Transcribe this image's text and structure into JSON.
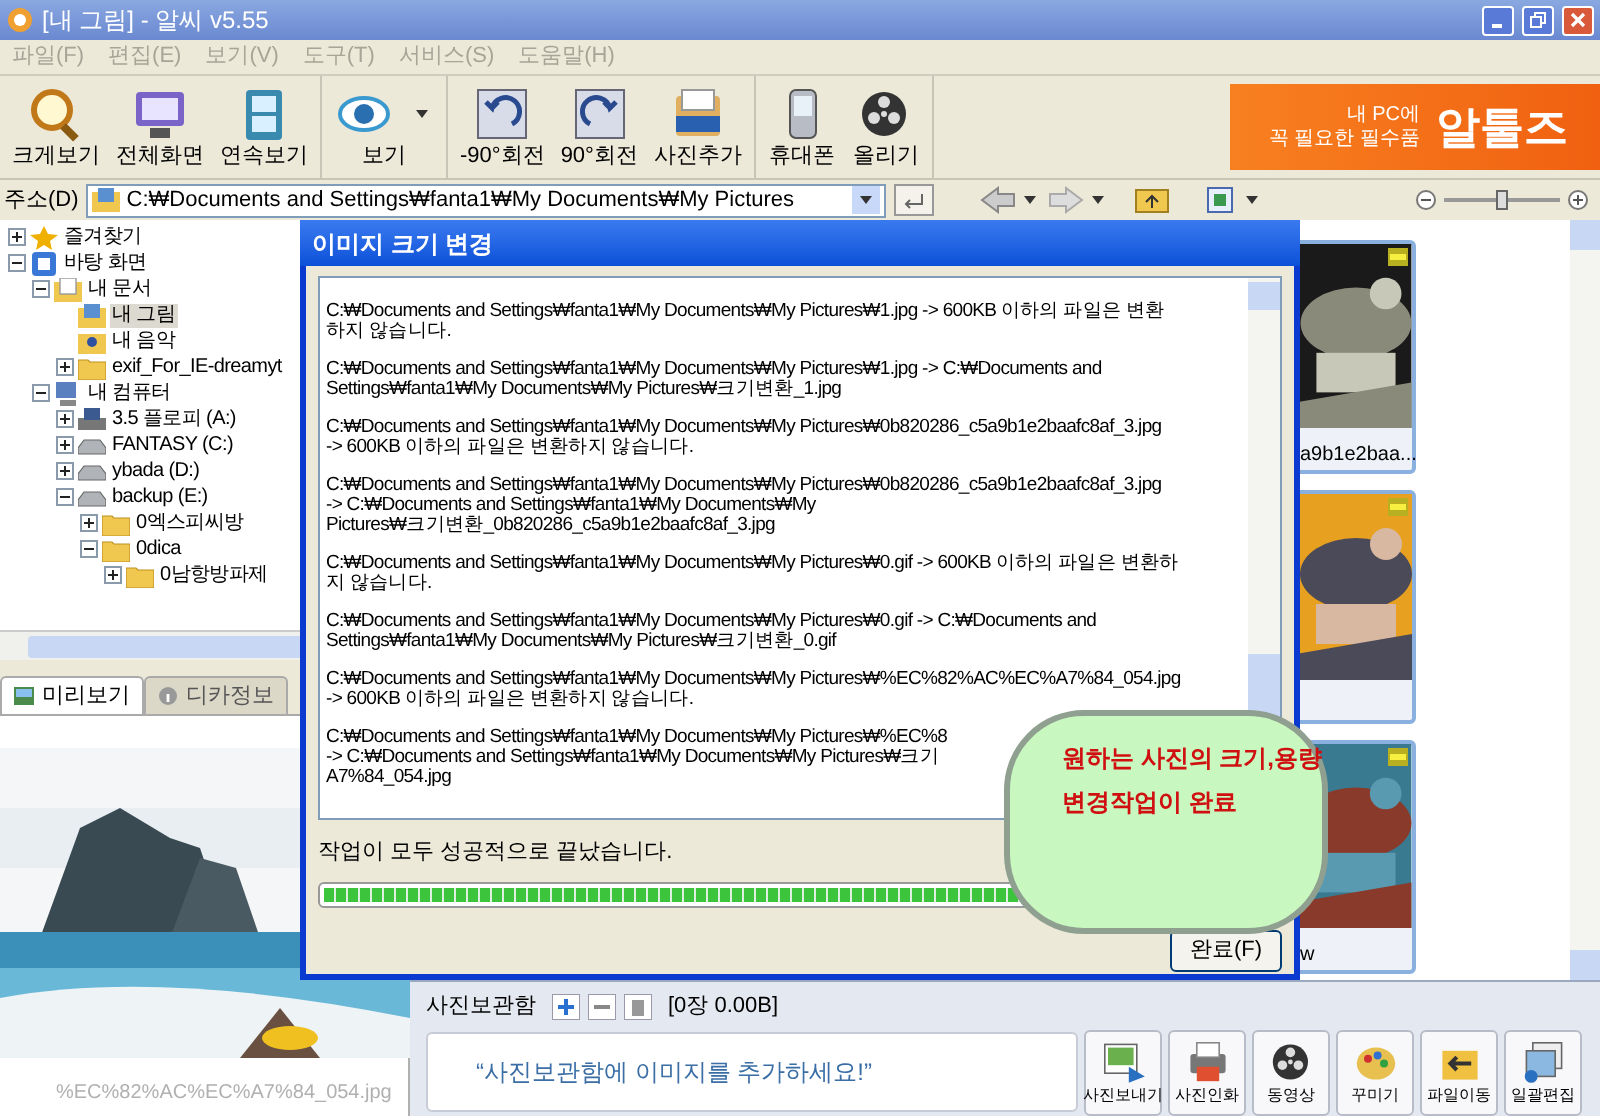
{
  "window": {
    "title": "[내 그림] - 알씨 v5.55"
  },
  "menu": [
    "파일(F)",
    "편집(E)",
    "보기(V)",
    "도구(T)",
    "서비스(S)",
    "도움말(H)"
  ],
  "toolbar": {
    "groups": [
      [
        {
          "label": "크게보기",
          "kind": "magnifier",
          "dropdown": false
        },
        {
          "label": "전체화면",
          "kind": "monitor",
          "dropdown": false
        },
        {
          "label": "연속보기",
          "kind": "film",
          "dropdown": false
        }
      ],
      [
        {
          "label": "보기",
          "kind": "eye",
          "dropdown": true
        }
      ],
      [
        {
          "label": "-90°회전",
          "kind": "rotate_left",
          "dropdown": false
        },
        {
          "label": "90°회전",
          "kind": "rotate_right",
          "dropdown": false
        },
        {
          "label": "사진추가",
          "kind": "box",
          "dropdown": false
        }
      ],
      [
        {
          "label": "휴대폰",
          "kind": "phone",
          "dropdown": false
        },
        {
          "label": "올리기",
          "kind": "reel",
          "dropdown": false
        }
      ]
    ]
  },
  "ad_banner": {
    "tagline": [
      "내 PC에",
      "꼭 필요한 필수품"
    ],
    "brand": "알툴즈"
  },
  "address_bar": {
    "label": "주소(D)",
    "value": "C:₩Documents and Settings₩fanta1₩My Documents₩My Pictures"
  },
  "zoom_slider": {
    "level": 0.5
  },
  "tree": [
    {
      "label": "즐겨찾기",
      "kind": "favorites",
      "expanded": false,
      "selected": false
    },
    {
      "label": "바탕 화면",
      "kind": "desktop",
      "expanded": true,
      "selected": false,
      "children": [
        {
          "label": "내 문서",
          "kind": "documents",
          "expanded": true,
          "selected": false,
          "children": [
            {
              "label": "내 그림",
              "kind": "pictures",
              "selected": true
            },
            {
              "label": "내 음악",
              "kind": "music",
              "selected": false
            },
            {
              "label": "exif_For_IE-dreamyt",
              "kind": "folder",
              "expanded": false,
              "selected": false
            }
          ]
        },
        {
          "label": "내 컴퓨터",
          "kind": "computer",
          "expanded": true,
          "selected": false,
          "children": [
            {
              "label": "3.5 플로피 (A:)",
              "kind": "floppy",
              "expanded": false,
              "selected": false
            },
            {
              "label": "FANTASY (C:)",
              "kind": "drive",
              "expanded": false,
              "selected": false
            },
            {
              "label": "ybada (D:)",
              "kind": "drive",
              "expanded": false,
              "selected": false
            },
            {
              "label": "backup (E:)",
              "kind": "drive",
              "expanded": true,
              "selected": false,
              "children": [
                {
                  "label": "0엑스피씨방",
                  "kind": "folder",
                  "expanded": false,
                  "selected": false
                },
                {
                  "label": "0dica",
                  "kind": "folder",
                  "expanded": true,
                  "selected": false,
                  "children": [
                    {
                      "label": "0남항방파제",
                      "kind": "folder",
                      "expanded": false,
                      "selected": false
                    }
                  ]
                }
              ]
            }
          ]
        }
      ]
    }
  ],
  "info_tabs": [
    {
      "label": "미리보기",
      "selected": true
    },
    {
      "label": "디카정보",
      "selected": false
    }
  ],
  "preview": {
    "filename": "%EC%82%AC%EC%A7%84_054.jpg"
  },
  "thumbnails": [
    {
      "kind": "picture",
      "caption": "a9b1e2baa..."
    },
    {
      "kind": "picture"
    },
    {
      "kind": "picture",
      "caption": "w"
    }
  ],
  "photo_tray": {
    "title": "사진보관함",
    "count": "[0장 0.00B]",
    "message": "“사진보관함에 이미지를 추가하세요!”",
    "actions": [
      {
        "label": "사진보내기",
        "kind": "send"
      },
      {
        "label": "사진인화",
        "kind": "print"
      },
      {
        "label": "동영상",
        "kind": "reel"
      },
      {
        "label": "꾸미기",
        "kind": "paint"
      },
      {
        "label": "파일이동",
        "kind": "move"
      },
      {
        "label": "일괄편집",
        "kind": "batch"
      }
    ]
  },
  "dialog": {
    "title": "이미지 크기 변경",
    "log": [
      {
        "lines": [
          "C:₩Documents and Settings₩fanta1₩My Documents₩My Pictures₩1.jpg -> 600KB 이하의 파일은 변환",
          "하지 않습니다."
        ]
      },
      {
        "lines": [
          "C:₩Documents and Settings₩fanta1₩My Documents₩My Pictures₩1.jpg -> C:₩Documents and",
          "Settings₩fanta1₩My Documents₩My Pictures₩크기변환_1.jpg"
        ]
      },
      {
        "lines": [
          "C:₩Documents and Settings₩fanta1₩My Documents₩My Pictures₩0b820286_c5a9b1e2baafc8af_3.jpg",
          "-> 600KB 이하의 파일은 변환하지 않습니다."
        ]
      },
      {
        "lines": [
          "C:₩Documents and Settings₩fanta1₩My Documents₩My Pictures₩0b820286_c5a9b1e2baafc8af_3.jpg",
          "-> C:₩Documents and Settings₩fanta1₩My Documents₩My",
          "Pictures₩크기변환_0b820286_c5a9b1e2baafc8af_3.jpg"
        ]
      },
      {
        "lines": [
          "C:₩Documents and Settings₩fanta1₩My Documents₩My Pictures₩0.gif -> 600KB 이하의 파일은 변환하",
          "지 않습니다."
        ]
      },
      {
        "lines": [
          "C:₩Documents and Settings₩fanta1₩My Documents₩My Pictures₩0.gif -> C:₩Documents and",
          "Settings₩fanta1₩My Documents₩My Pictures₩크기변환_0.gif"
        ]
      },
      {
        "lines": [
          "C:₩Documents and Settings₩fanta1₩My Documents₩My Pictures₩%EC%82%AC%EC%A7%84_054.jpg",
          "-> 600KB 이하의 파일은 변환하지 않습니다."
        ]
      },
      {
        "lines": [
          "C:₩Documents and Settings₩fanta1₩My Documents₩My Pictures₩%EC%8",
          "-> C:₩Documents and Settings₩fanta1₩My Documents₩My Pictures₩크기",
          "A7%84_054.jpg"
        ]
      }
    ],
    "status": "작업이 모두 성공적으로 끝났습니다.",
    "progress": {
      "level": 1
    },
    "button": "완료(F)"
  },
  "callout": {
    "lines": [
      "원하는 사진의 크기,용량",
      "변경작업이 완료"
    ]
  }
}
